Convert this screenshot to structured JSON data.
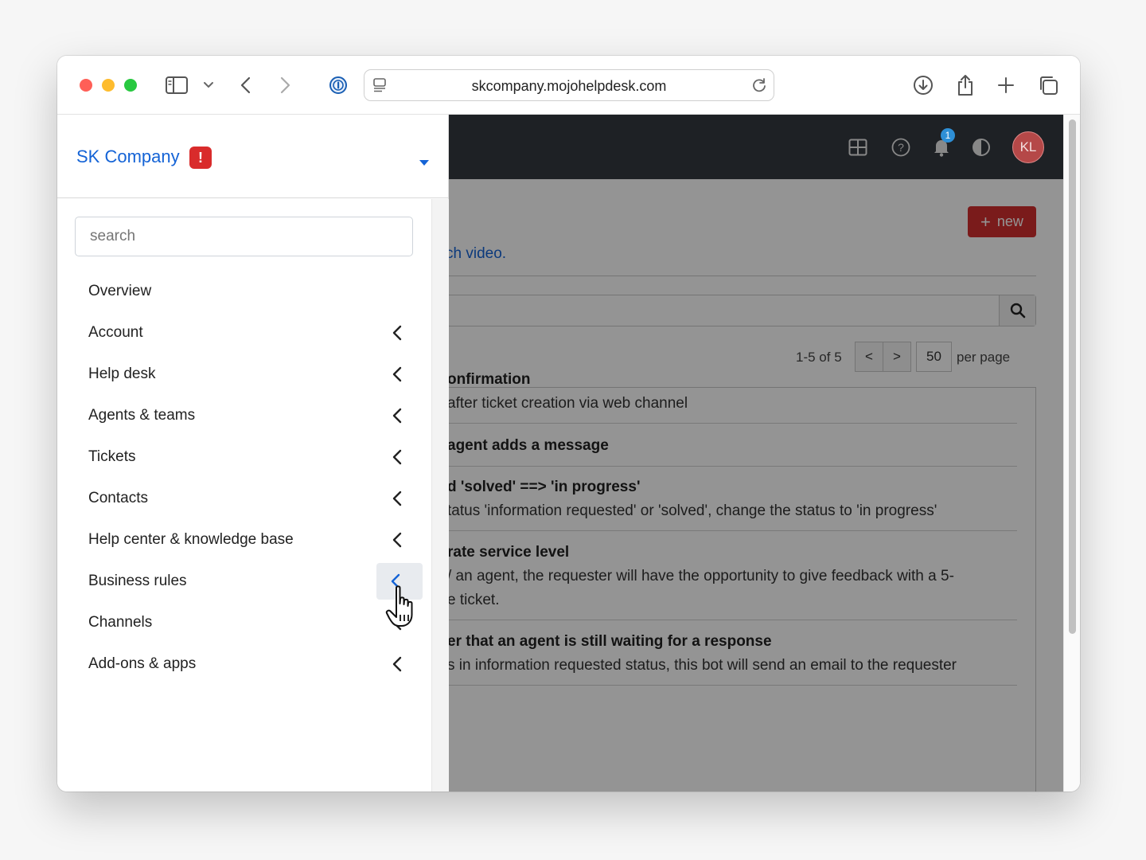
{
  "browser": {
    "url": "skcompany.mojohelpdesk.com"
  },
  "sidebar": {
    "company_name": "SK Company",
    "alert_badge": "!",
    "search_placeholder": "search",
    "items": [
      {
        "label": "Overview",
        "has_chevron": false
      },
      {
        "label": "Account",
        "has_chevron": true
      },
      {
        "label": "Help desk",
        "has_chevron": true
      },
      {
        "label": "Agents & teams",
        "has_chevron": true
      },
      {
        "label": "Tickets",
        "has_chevron": true
      },
      {
        "label": "Contacts",
        "has_chevron": true
      },
      {
        "label": "Help center & knowledge base",
        "has_chevron": true
      },
      {
        "label": "Business rules",
        "has_chevron": true
      },
      {
        "label": "Channels",
        "has_chevron": true
      },
      {
        "label": "Add-ons & apps",
        "has_chevron": true
      }
    ]
  },
  "app": {
    "notification_count": "1",
    "avatar_initials": "KL",
    "new_button_label": "new",
    "video_link": "ch video.",
    "pager": {
      "range": "1-5 of 5",
      "prev": "<",
      "next": ">",
      "per_page_value": "50",
      "per_page_label": "per page"
    },
    "rules": [
      {
        "title": "onfirmation",
        "desc": " after ticket creation via web channel"
      },
      {
        "title": "agent adds a message",
        "desc": ""
      },
      {
        "title": "d 'solved' ==> 'in progress'",
        "desc": "tatus 'information requested' or 'solved', change the status to 'in progress'"
      },
      {
        "title": "rate service level",
        "desc": "/ an agent, the requester will have the opportunity to give feedback with a 5-",
        "desc2": "e ticket."
      },
      {
        "title": "er that an agent is still waiting for a response",
        "desc": "s in information requested status, this bot will send an email to the requester"
      }
    ]
  },
  "colors": {
    "accent": "#1463d6",
    "danger": "#d32f2f",
    "topbar": "#1e2125"
  }
}
